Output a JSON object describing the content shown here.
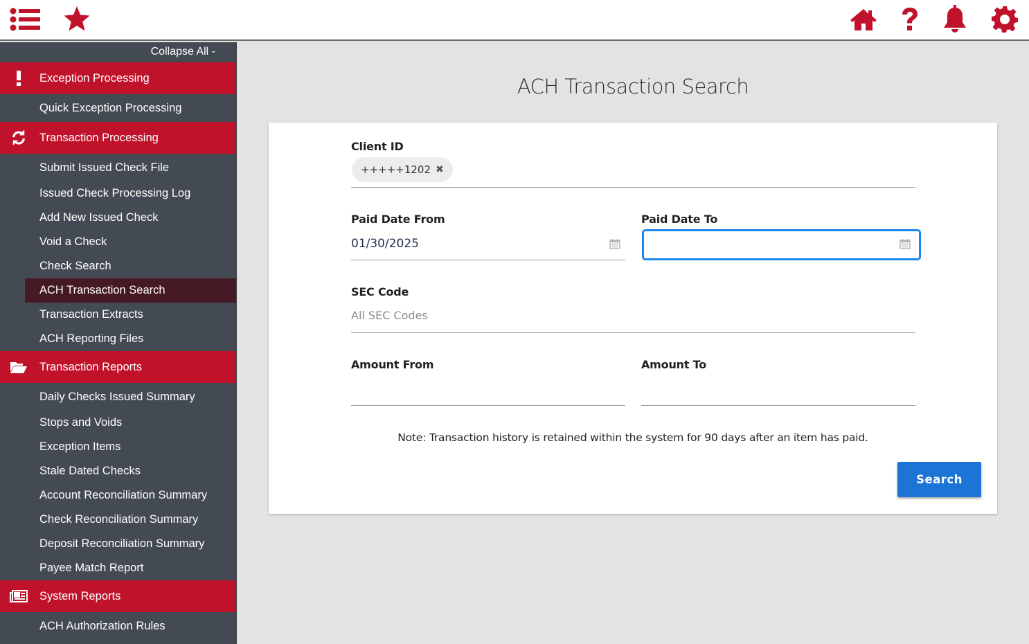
{
  "topbar": {
    "left_icons": [
      "menu-list-icon",
      "star-icon"
    ],
    "right_icons": [
      "home-icon",
      "help-icon",
      "bell-icon",
      "gear-icon"
    ],
    "accent_color": "#c0132b"
  },
  "sidebar": {
    "collapse_label": "Collapse All -",
    "sections": [
      {
        "label": "Exception Processing",
        "icon": "exclamation-icon",
        "items": [
          "Quick Exception Processing"
        ]
      },
      {
        "label": "Transaction Processing",
        "icon": "refresh-icon",
        "items": [
          "Submit Issued Check File",
          "Issued Check Processing Log",
          "Add New Issued Check",
          "Void a Check",
          "Check Search",
          "ACH Transaction Search",
          "Transaction Extracts",
          "ACH Reporting Files"
        ]
      },
      {
        "label": "Transaction Reports",
        "icon": "folder-open-icon",
        "items": [
          "Daily Checks Issued Summary",
          "Stops and Voids",
          "Exception Items",
          "Stale Dated Checks",
          "Account Reconciliation Summary",
          "Check Reconciliation Summary",
          "Deposit Reconciliation Summary",
          "Payee Match Report"
        ]
      },
      {
        "label": "System Reports",
        "icon": "newspaper-icon",
        "items": [
          "ACH Authorization Rules"
        ]
      }
    ],
    "active_item": "ACH Transaction Search"
  },
  "main": {
    "title": "ACH Transaction Search",
    "form": {
      "client_id": {
        "label": "Client ID",
        "chip": "+++++1202",
        "chip_remove": "✖"
      },
      "paid_date_from": {
        "label": "Paid Date From",
        "value": "01/30/2025"
      },
      "paid_date_to": {
        "label": "Paid Date To",
        "value": ""
      },
      "sec_code": {
        "label": "SEC Code",
        "placeholder": "All SEC Codes"
      },
      "amount_from": {
        "label": "Amount From",
        "value": ""
      },
      "amount_to": {
        "label": "Amount To",
        "value": ""
      }
    },
    "note": "Note: Transaction history is retained within the system for 90 days after an item has paid.",
    "search_button": "Search",
    "button_color": "#1b74d6",
    "focus_color": "#1a86ee"
  }
}
